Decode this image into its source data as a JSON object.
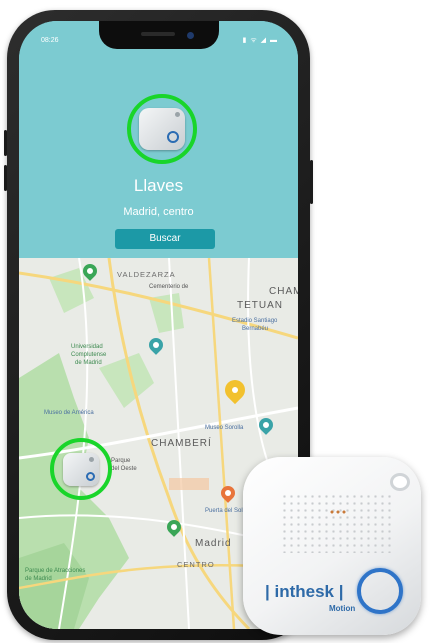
{
  "status_bar": {
    "time": "08:26",
    "icons": "▮ ᯤ ◢ ▬"
  },
  "item": {
    "name": "Llaves",
    "location": "Madrid, centro"
  },
  "actions": {
    "search_label": "Buscar"
  },
  "map": {
    "labels": {
      "valdezarza": "VALDEZARZA",
      "cementerio": "Cementerio de",
      "tetuan_top": "CHAM",
      "tetuan": "TETUAN",
      "estadio": "Estadio Santiago",
      "bernabeu": "Bernabéu",
      "universidad": "Universidad",
      "complutense": "Complutense",
      "de_madrid": "de Madrid",
      "museo_america": "Museo de América",
      "chamberi": "CHAMBERÍ",
      "museo_sorolla": "Museo Sorolla",
      "templo_debod": "Parque",
      "oeste": "del Oeste",
      "puerta_sol": "Puerta del Sol",
      "madrid": "Madrid",
      "centro": "CENTRO",
      "parque_atracciones": "Parque de Atracciones",
      "de_madrid_2": "de Madrid"
    }
  },
  "product": {
    "brand": "| inthesk |",
    "model": "Motion"
  },
  "colors": {
    "header_bg": "#7ccbd1",
    "button_bg": "#1c99a6",
    "highlight_ring": "#19d52a",
    "brand_blue": "#2e6aa8"
  }
}
